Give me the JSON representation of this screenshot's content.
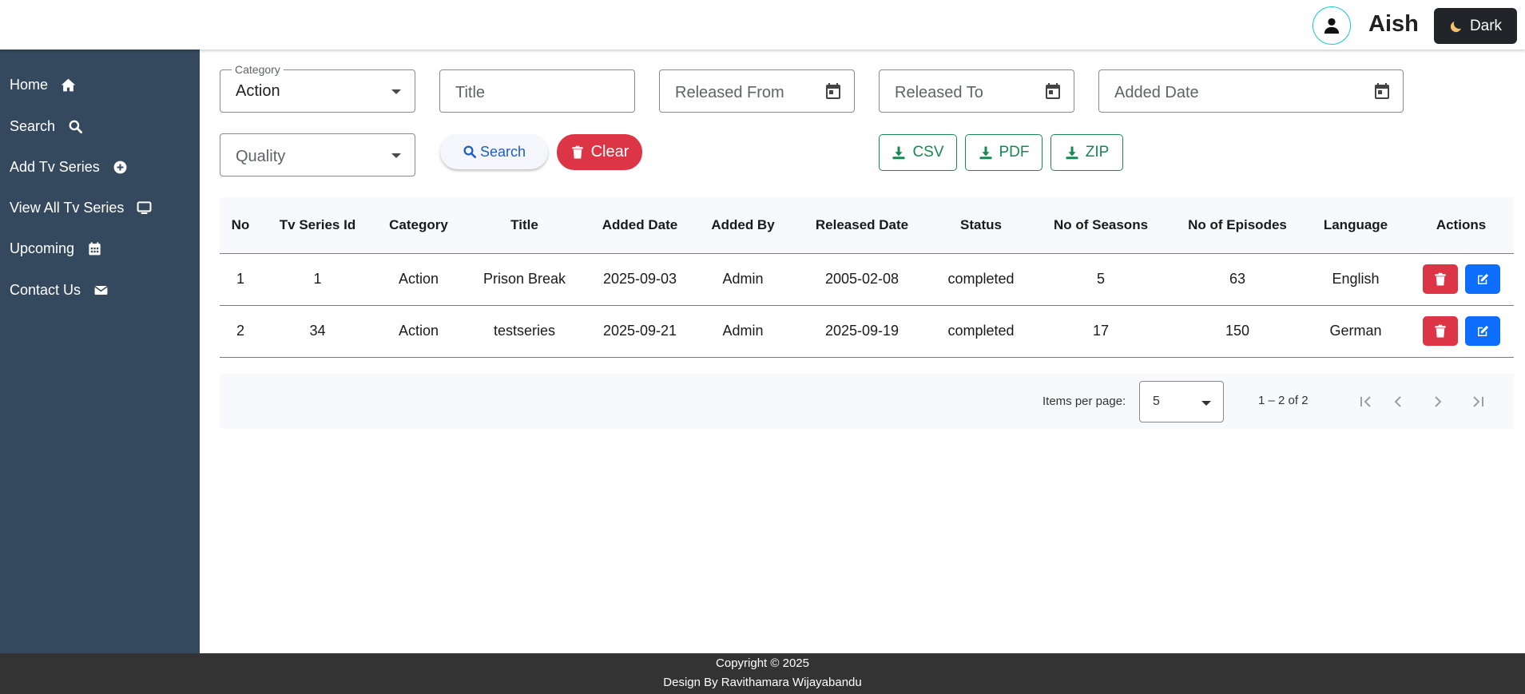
{
  "header": {
    "username": "Aish",
    "theme_button": "Dark"
  },
  "sidebar": {
    "items": [
      {
        "label": "Home",
        "icon": "home-icon"
      },
      {
        "label": "Search",
        "icon": "search-icon"
      },
      {
        "label": "Add Tv Series",
        "icon": "plus-circle-icon"
      },
      {
        "label": "View All Tv Series",
        "icon": "tv-icon"
      },
      {
        "label": "Upcoming",
        "icon": "calendar-icon"
      },
      {
        "label": "Contact Us",
        "icon": "envelope-icon"
      }
    ]
  },
  "filters": {
    "category_label": "Category",
    "category_value": "Action",
    "title_placeholder": "Title",
    "released_from_placeholder": "Released From",
    "released_to_placeholder": "Released To",
    "added_date_placeholder": "Added Date",
    "quality_placeholder": "Quality"
  },
  "actions": {
    "search_label": "Search",
    "clear_label": "Clear",
    "csv_label": "CSV",
    "pdf_label": "PDF",
    "zip_label": "ZIP"
  },
  "table": {
    "columns": [
      "No",
      "Tv Series Id",
      "Category",
      "Title",
      "Added Date",
      "Added By",
      "Released Date",
      "Status",
      "No of Seasons",
      "No of Episodes",
      "Language",
      "Actions"
    ],
    "rows": [
      {
        "no": "1",
        "id": "1",
        "category": "Action",
        "title": "Prison Break",
        "added_date": "2025-09-03",
        "added_by": "Admin",
        "released_date": "2005-02-08",
        "status": "completed",
        "seasons": "5",
        "episodes": "63",
        "language": "English"
      },
      {
        "no": "2",
        "id": "34",
        "category": "Action",
        "title": "testseries",
        "added_date": "2025-09-21",
        "added_by": "Admin",
        "released_date": "2025-09-19",
        "status": "completed",
        "seasons": "17",
        "episodes": "150",
        "language": "German"
      }
    ]
  },
  "paginator": {
    "items_per_page_label": "Items per page:",
    "page_size": "5",
    "range": "1 – 2 of 2"
  },
  "footer": {
    "copyright": "Copyright © 2025",
    "design": "Design By Ravithamara Wijayabandu"
  },
  "colors": {
    "sidebar_bg": "#34495e",
    "danger": "#dc3545",
    "primary": "#0d6efd",
    "success": "#198754",
    "footer_bg": "#333333",
    "avatar_ring": "#17c7d6"
  }
}
